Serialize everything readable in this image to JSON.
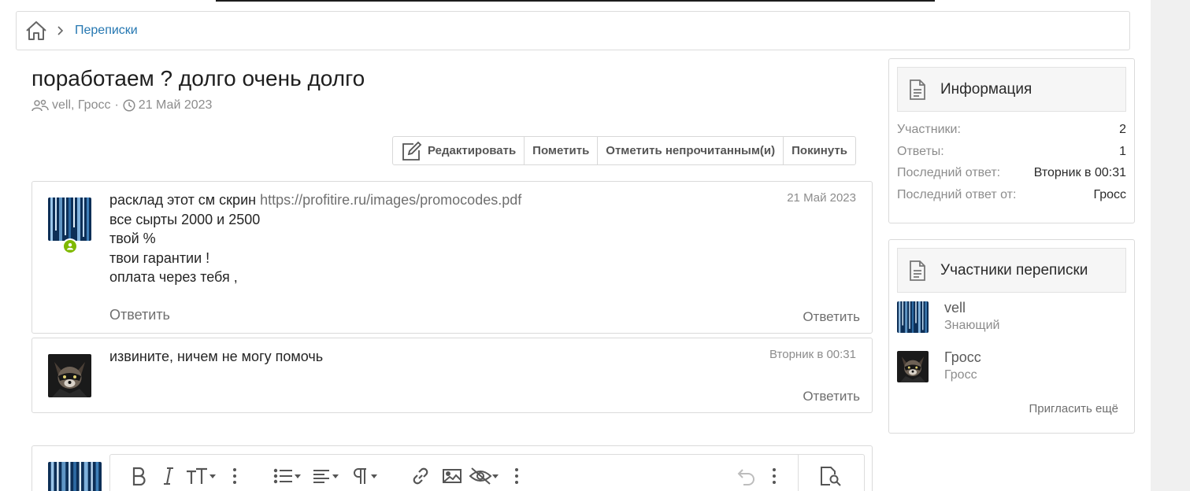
{
  "breadcrumb": {
    "items": [
      "Переписки"
    ]
  },
  "thread": {
    "title": "поработаем ? долго очень долго",
    "participants_text": "vell, Гросс",
    "meta_separator": "·",
    "date": "21 Май 2023"
  },
  "actions": {
    "edit": "Редактировать",
    "mark": "Пометить",
    "mark_unread": "Отметить непрочитанным(и)",
    "leave": "Покинуть"
  },
  "messages": [
    {
      "first_line_text": "расклад этот см скрин ",
      "link": "https://profitire.ru/images/promocodes.pdf",
      "lines": [
        "все сырты 2000 и 2500",
        "твой %",
        "твои гарантии !",
        "оплата через тебя ,"
      ],
      "date": "21 Май 2023",
      "reply_left": "Ответить",
      "reply_right": "Ответить"
    },
    {
      "text": "извините, ничем не могу помочь",
      "date": "Вторник в 00:31",
      "reply_right": "Ответить"
    }
  ],
  "sidebar": {
    "info": {
      "title": "Информация",
      "rows": [
        {
          "label": "Участники:",
          "value": "2"
        },
        {
          "label": "Ответы:",
          "value": "1"
        },
        {
          "label": "Последний ответ:",
          "value": "Вторник в 00:31"
        },
        {
          "label": "Последний ответ от:",
          "value": "Гросс"
        }
      ]
    },
    "participants": {
      "title": "Участники переписки",
      "members": [
        {
          "name": "vell",
          "role": "Знающий"
        },
        {
          "name": "Гросс",
          "role": "Гросс"
        }
      ],
      "invite": "Пригласить ещё"
    }
  },
  "colors": {
    "link": "#2577b1",
    "online": "#7fb900",
    "muted": "#8c8c8c"
  },
  "icons": [
    "home-icon",
    "chevron-right-icon",
    "users-icon",
    "clock-icon",
    "edit-icon",
    "user-icon",
    "document-icon",
    "bold-icon",
    "italic-icon",
    "text-size-icon",
    "more-icon",
    "list-icon",
    "align-icon",
    "paragraph-icon",
    "link-icon",
    "image-icon",
    "hide-icon",
    "undo-icon",
    "preview-icon"
  ]
}
